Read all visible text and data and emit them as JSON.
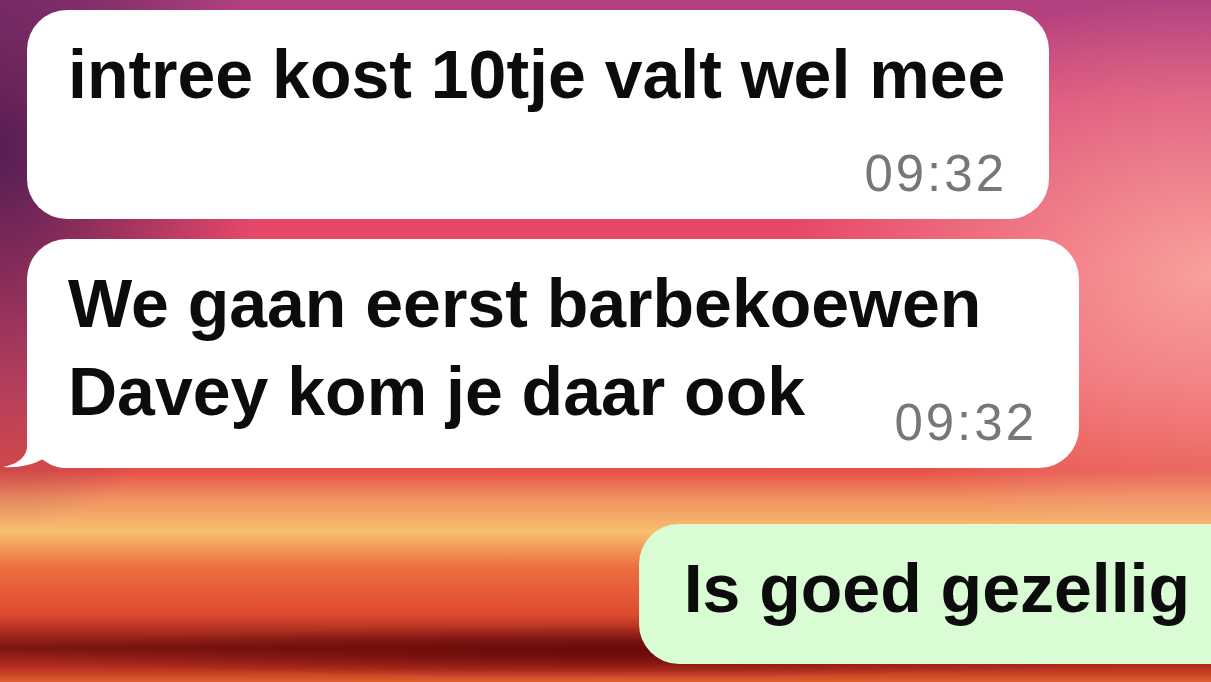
{
  "messages": [
    {
      "kind": "incoming",
      "text": "intree kost 10tje valt wel mee",
      "time": "09:32",
      "tail": false
    },
    {
      "kind": "incoming",
      "text": "We gaan eerst barbekoewen Davey kom je daar ook",
      "time": "09:32",
      "tail": true
    },
    {
      "kind": "outgoing",
      "text": "Is goed gezellig",
      "tail": false
    }
  ]
}
